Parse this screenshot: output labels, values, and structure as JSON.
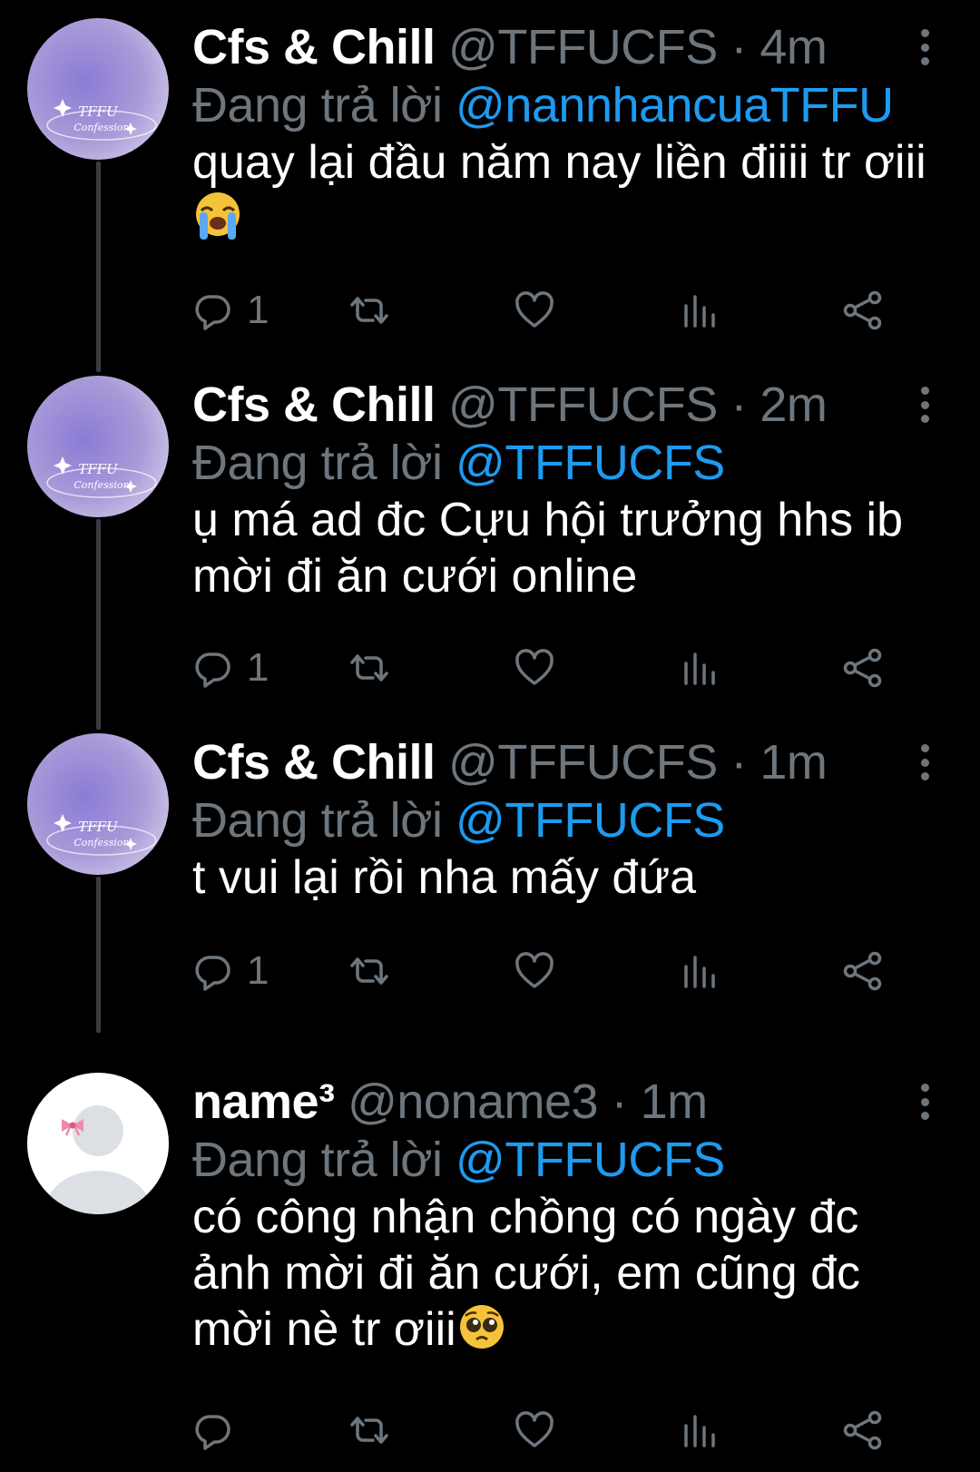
{
  "colors": {
    "background": "#000000",
    "muted": "#6e767d",
    "link": "#1d9bf0",
    "text": "#ffffff",
    "thread_line": "#3a3d42"
  },
  "labels": {
    "replying_prefix": "Đang trả lời",
    "separator": "·"
  },
  "tweets": [
    {
      "avatar": "tffu-confession-avatar",
      "avatar_text_1": "TFFU",
      "avatar_text_2": "Confession",
      "display_name": "Cfs & Chill",
      "handle": "@TFFUCFS",
      "time": "4m",
      "reply_to": "@nannhancuaTFFU",
      "text": "quay lại đầu năm nay liền điiii tr ơiii",
      "emoji": "loudly-crying-face",
      "reply_count": "1"
    },
    {
      "avatar": "tffu-confession-avatar",
      "avatar_text_1": "TFFU",
      "avatar_text_2": "Confession",
      "display_name": "Cfs & Chill",
      "handle": "@TFFUCFS",
      "time": "2m",
      "reply_to": "@TFFUCFS",
      "text": "ụ má ad đc Cựu hội trưởng hhs ib mời đi ăn cưới online",
      "emoji": "",
      "reply_count": "1"
    },
    {
      "avatar": "tffu-confession-avatar",
      "avatar_text_1": "TFFU",
      "avatar_text_2": "Confession",
      "display_name": "Cfs & Chill",
      "handle": "@TFFUCFS",
      "time": "1m",
      "reply_to": "@TFFUCFS",
      "text": "t vui lại rồi nha mấy đứa",
      "emoji": "",
      "reply_count": "1"
    },
    {
      "avatar": "default-avatar-with-bow",
      "display_name": "name³",
      "handle": "@noname3",
      "time": "1m",
      "reply_to": "@TFFUCFS",
      "text": "có công nhận chồng có ngày đc ảnh mời đi ăn cưới, em cũng đc mời nè tr ơiii",
      "emoji": "pleading-face",
      "reply_count": ""
    }
  ],
  "icons": {
    "reply": "reply-icon",
    "retweet": "retweet-icon",
    "like": "heart-icon",
    "analytics": "analytics-icon",
    "share": "share-icon",
    "more": "more-vertical-icon"
  }
}
